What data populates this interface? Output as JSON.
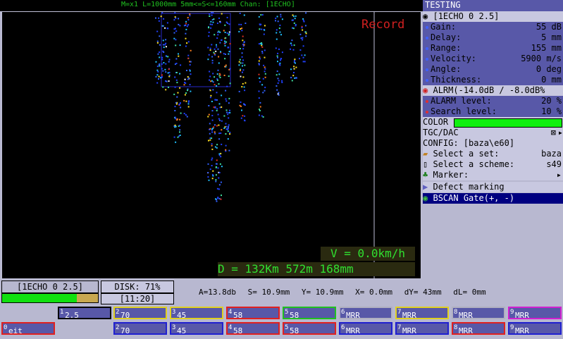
{
  "topbar": {
    "text": "M=x1  L=1000mm 5mm<=S<=160mm Chan: [1ECHO]"
  },
  "screen": {
    "record": "Record",
    "speed": "V = 0.0km/h",
    "distance": "D =  132Km  572m  168mm"
  },
  "menu": {
    "title": "TESTING",
    "channel": "[1ECHO 0 2.5]",
    "params": [
      {
        "label": "Gain:",
        "value": "55 dB"
      },
      {
        "label": "Delay:",
        "value": "5 mm"
      },
      {
        "label": "Range:",
        "value": "155 mm"
      },
      {
        "label": "Velocity:",
        "value": "5900 m/s"
      },
      {
        "label": "Angle:",
        "value": "0 deg"
      },
      {
        "label": "Thickness:",
        "value": "0 mm"
      }
    ],
    "alarm": "ALRM(-14.0dB / -8.0dB%",
    "alarm_params": [
      {
        "label": "ALARM level:",
        "value": "20 %"
      },
      {
        "label": "Search level:",
        "value": "10 %"
      }
    ],
    "color_label": "COLOR",
    "tgc_label": "TGC/DAC",
    "config_label": "CONFIG: [baza\\e60]",
    "select_set": {
      "label": "Select a set:",
      "value": "baza"
    },
    "select_scheme": {
      "label": "Select a scheme:",
      "value": "s49"
    },
    "marker": "Marker:",
    "defect": "Defect marking",
    "bscan_gate": "BSCAN Gate(+, -)"
  },
  "status": {
    "channel": "[1ECHO 0 2.5]",
    "disk": "DISK: 71%",
    "time": "[11:20]",
    "disk_fill": 0.78
  },
  "readout": [
    "A=13.8db",
    "S= 10.9mm",
    "Y= 10.9mm",
    "X=  0.0mm",
    "dY= 43mm",
    "dL=  0mm"
  ],
  "buttons_top": [
    {
      "n": "1",
      "t": "2.5",
      "border": "#000000"
    },
    {
      "n": "2",
      "t": "70",
      "border": "#e0d020"
    },
    {
      "n": "3",
      "t": "45",
      "border": "#e0d020"
    },
    {
      "n": "4",
      "t": "58",
      "border": "#e02020"
    },
    {
      "n": "5",
      "t": "58",
      "border": "#20c020"
    },
    {
      "n": "6",
      "t": "MRR",
      "border": "#b0b0c0"
    },
    {
      "n": "7",
      "t": "MRR",
      "border": "#e0d020"
    },
    {
      "n": "8",
      "t": "MRR",
      "border": "#b0b0c0"
    },
    {
      "n": "9",
      "t": "MRR",
      "border": "#d020d0"
    }
  ],
  "buttons_bottom": [
    {
      "n": "0",
      "t": "eit",
      "border": "#e02020"
    },
    {
      "n": "2",
      "t": "70",
      "border": "#2020d0"
    },
    {
      "n": "3",
      "t": "45",
      "border": "#2020d0"
    },
    {
      "n": "4",
      "t": "58",
      "border": "#e02020"
    },
    {
      "n": "5",
      "t": "58",
      "border": "#e02020"
    },
    {
      "n": "6",
      "t": "MRR",
      "border": "#2020d0"
    },
    {
      "n": "7",
      "t": "MRR",
      "border": "#2020d0"
    },
    {
      "n": "8",
      "t": "MRR",
      "border": "#e02020"
    },
    {
      "n": "9",
      "t": "MRR",
      "border": "#2020d0"
    }
  ]
}
